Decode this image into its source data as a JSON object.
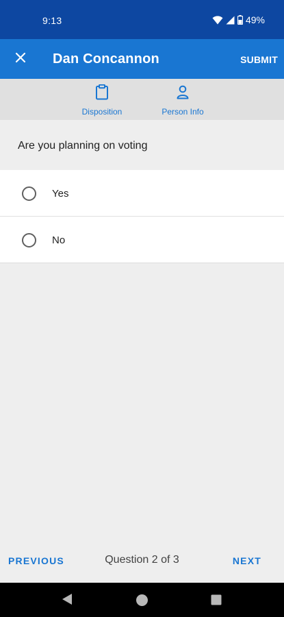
{
  "status_bar": {
    "time": "9:13",
    "battery": "49%",
    "icons": [
      "wifi-icon",
      "cell-signal-icon",
      "battery-icon"
    ]
  },
  "app_bar": {
    "close_icon": "close-icon",
    "title": "Dan Concannon",
    "submit_label": "SUBMIT"
  },
  "tabs": [
    {
      "label": "Disposition",
      "icon": "clipboard-icon"
    },
    {
      "label": "Person Info",
      "icon": "person-icon"
    }
  ],
  "question": {
    "text": "Are you planning on voting",
    "options": [
      {
        "label": "Yes",
        "selected": false
      },
      {
        "label": "No",
        "selected": false
      }
    ]
  },
  "footer": {
    "previous_label": "PREVIOUS",
    "counter": "Question 2 of 3",
    "next_label": "NEXT"
  },
  "system_nav": [
    "back-icon",
    "home-icon",
    "recents-icon"
  ],
  "colors": {
    "status_bar": "#0d47a1",
    "app_bar": "#1976d2",
    "accent": "#1976d2",
    "background": "#eeeeee"
  }
}
